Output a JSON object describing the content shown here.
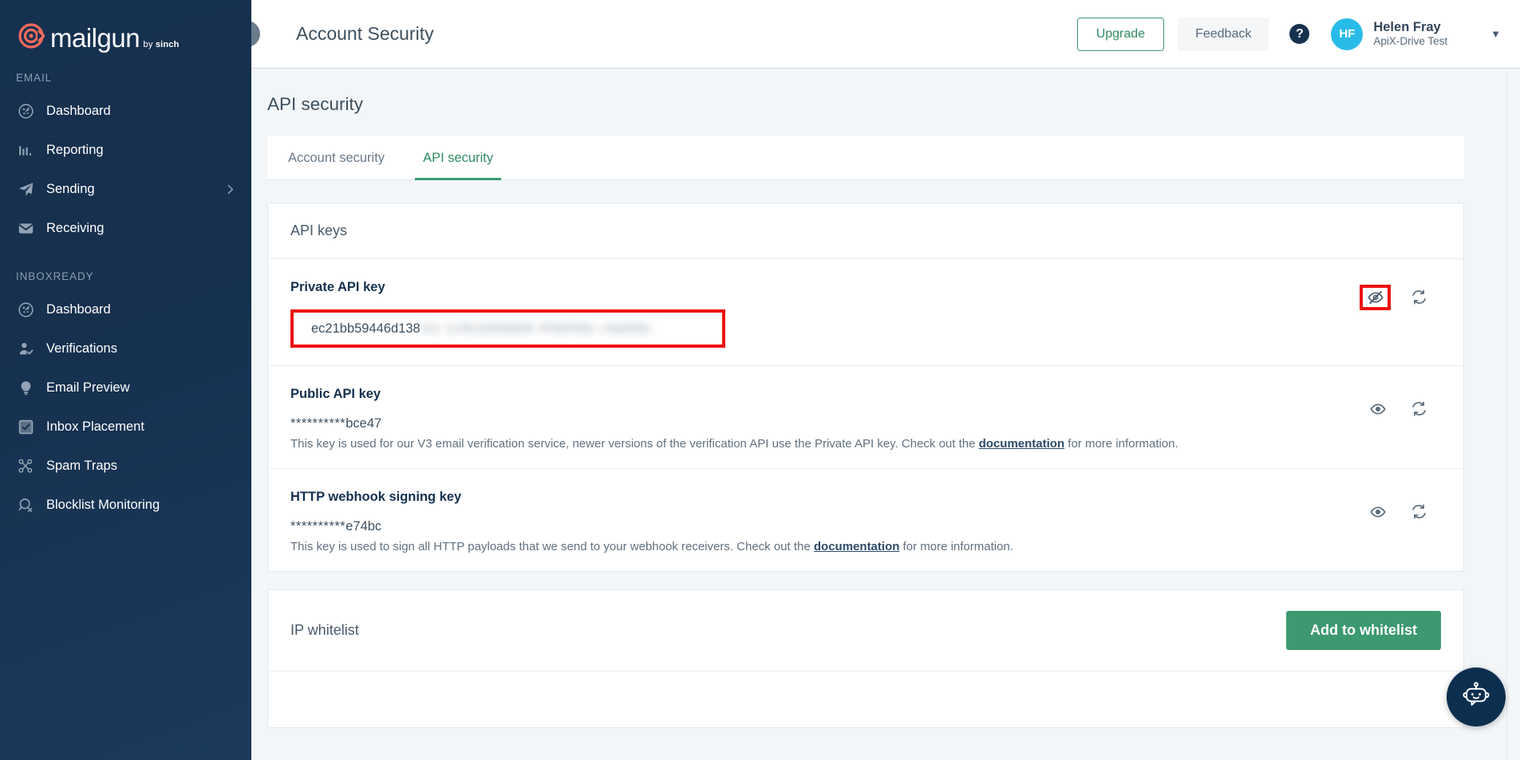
{
  "sidebar": {
    "logo": {
      "word": "mailgun",
      "by": "by ",
      "brand": "sinch"
    },
    "sections": [
      {
        "label": "EMAIL",
        "items": [
          {
            "label": "Dashboard",
            "icon": "gauge-icon",
            "chevron": false
          },
          {
            "label": "Reporting",
            "icon": "bar-chart-icon",
            "chevron": false
          },
          {
            "label": "Sending",
            "icon": "paper-plane-icon",
            "chevron": true
          },
          {
            "label": "Receiving",
            "icon": "envelope-icon",
            "chevron": false
          }
        ]
      },
      {
        "label": "INBOXREADY",
        "items": [
          {
            "label": "Dashboard",
            "icon": "gauge-icon",
            "chevron": false
          },
          {
            "label": "Verifications",
            "icon": "user-check-icon",
            "chevron": false
          },
          {
            "label": "Email Preview",
            "icon": "lightbulb-icon",
            "chevron": false
          },
          {
            "label": "Inbox Placement",
            "icon": "checkbox-icon",
            "chevron": false
          },
          {
            "label": "Spam Traps",
            "icon": "network-nodes-icon",
            "chevron": false
          },
          {
            "label": "Blocklist Monitoring",
            "icon": "search-x-icon",
            "chevron": false
          }
        ]
      }
    ]
  },
  "topbar": {
    "collapse_icon": "‹",
    "heading": "Account Security",
    "upgrade_label": "Upgrade",
    "feedback_label": "Feedback",
    "help_label": "?",
    "avatar_initials": "HF",
    "user_name": "Helen Fray",
    "user_org": "ApiX-Drive Test",
    "caret": "▼"
  },
  "page": {
    "title": "API security",
    "tabs": [
      {
        "label": "Account security",
        "active": false
      },
      {
        "label": "API security",
        "active": true
      }
    ]
  },
  "api_keys": {
    "card_title": "API keys",
    "rows": [
      {
        "label": "Private API key",
        "value_visible": "ec21bb59446d138",
        "value_blurred": "m1 1cf61b68dbf8 4f3bf58c c9afb8c",
        "stars": "",
        "description": "",
        "doc_link": "",
        "description_tail": "",
        "eye_icon": "eye-slash-icon",
        "refresh_icon": "refresh-icon"
      },
      {
        "label": "Public API key",
        "value_visible": "bce47",
        "value_blurred": "",
        "stars": "**********",
        "description": "This key is used for our V3 email verification service, newer versions of the verification API use the Private API key. Check out the ",
        "doc_link": "documentation",
        "description_tail": " for more information.",
        "eye_icon": "eye-icon",
        "refresh_icon": "refresh-icon"
      },
      {
        "label": "HTTP webhook signing key",
        "value_visible": "e74bc",
        "value_blurred": "",
        "stars": "**********",
        "description": "This key is used to sign all HTTP payloads that we send to your webhook receivers. Check out the ",
        "doc_link": "documentation",
        "description_tail": " for more information.",
        "eye_icon": "eye-icon",
        "refresh_icon": "refresh-icon"
      }
    ]
  },
  "ip_whitelist": {
    "title": "IP whitelist",
    "button_label": "Add to whitelist"
  },
  "chatbot": {
    "icon": "chatbot-icon"
  },
  "colors": {
    "sidebar_bg": "#16314f",
    "accent_green": "#3c9970",
    "highlight_red": "#ee1111",
    "avatar_blue": "#29bbe8",
    "logo_coral": "#f46b5d",
    "content_bg": "#f2f6f9"
  }
}
